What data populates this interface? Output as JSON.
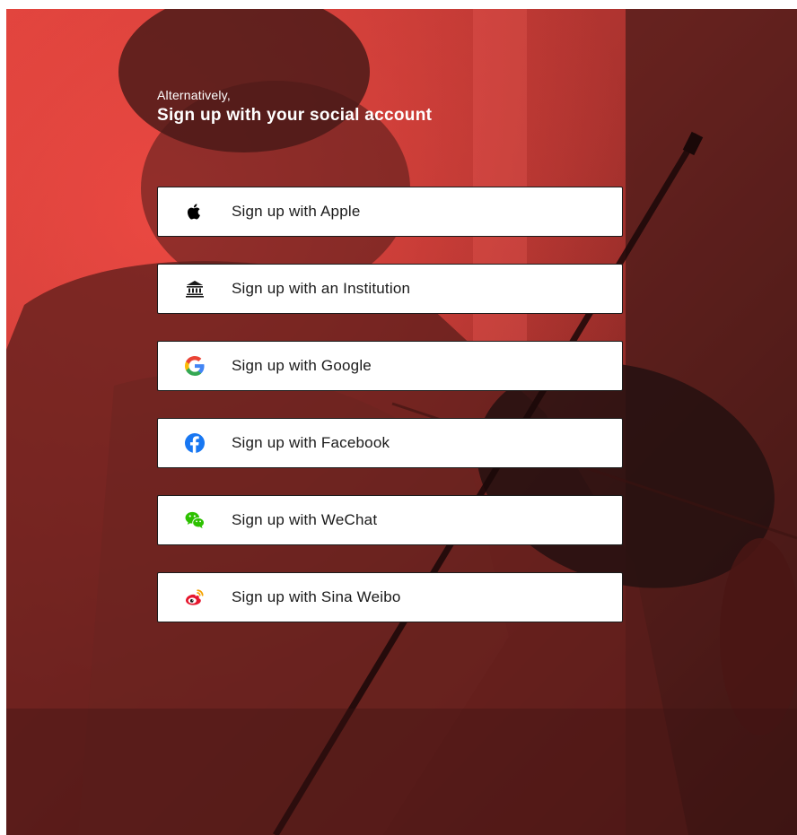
{
  "intro": {
    "small_text": "Alternatively,",
    "heading": "Sign up with your social account"
  },
  "buttons": [
    {
      "label": "Sign up with Apple",
      "icon": "apple-icon"
    },
    {
      "label": "Sign up with an Institution",
      "icon": "institution-icon"
    },
    {
      "label": "Sign up with Google",
      "icon": "google-icon"
    },
    {
      "label": "Sign up with Facebook",
      "icon": "facebook-icon"
    },
    {
      "label": "Sign up with WeChat",
      "icon": "wechat-icon"
    },
    {
      "label": "Sign up with Sina Weibo",
      "icon": "weibo-icon"
    }
  ],
  "colors": {
    "background_tint": "#c23a34",
    "button_background": "#ffffff",
    "button_border": "#1c1c1c",
    "google_blue": "#4285f4",
    "google_red": "#ea4335",
    "google_yellow": "#fbbc05",
    "google_green": "#34a853",
    "facebook_blue": "#1877f2",
    "wechat_green": "#2dc100",
    "weibo_red": "#e6162d"
  }
}
